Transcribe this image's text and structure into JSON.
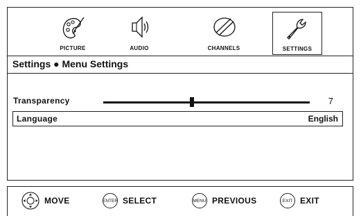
{
  "tabs": [
    {
      "label": "PICTURE",
      "icon": "palette-icon",
      "selected": false
    },
    {
      "label": "AUDIO",
      "icon": "speaker-icon",
      "selected": false
    },
    {
      "label": "CHANNELS",
      "icon": "satellite-dish-icon",
      "selected": false
    },
    {
      "label": "SETTINGS",
      "icon": "wrench-icon",
      "selected": true
    }
  ],
  "breadcrumb": "Settings ● Menu Settings",
  "settings": {
    "transparency": {
      "label": "Transparency",
      "value": "7",
      "level": 0.43
    },
    "language": {
      "label": "Language",
      "value": "English"
    }
  },
  "hints": [
    {
      "button": "",
      "label": "MOVE",
      "icon": "dpad-icon"
    },
    {
      "button": "ENTER",
      "label": "SELECT",
      "icon": "enter-button-icon"
    },
    {
      "button": "MENU",
      "label": "PREVIOUS",
      "icon": "menu-button-icon"
    },
    {
      "button": "EXIT",
      "label": "EXIT",
      "icon": "exit-button-icon"
    }
  ]
}
